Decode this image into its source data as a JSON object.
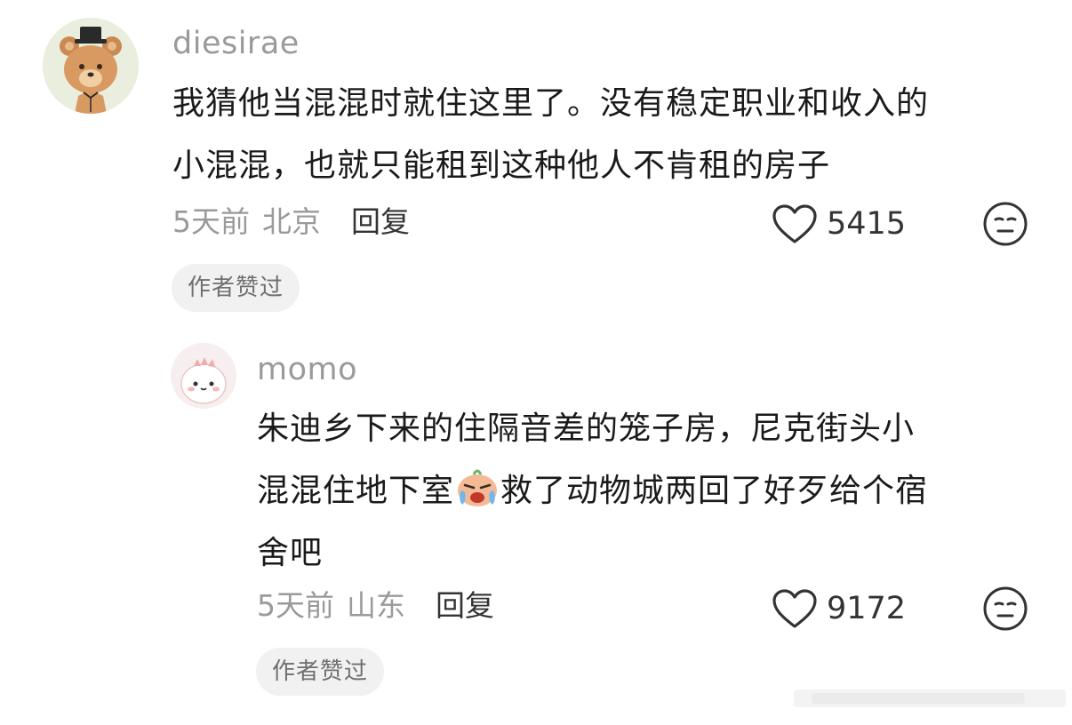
{
  "comments": [
    {
      "username": "diesirae",
      "text_line1": "我猜他当混混时就住这里了。没有稳定职业和收入的",
      "text_line2": "小混混，也就只能租到这种他人不肯租的房子",
      "time": "5天前",
      "region": "北京",
      "reply_label": "回复",
      "likes": "5415",
      "badge": "作者赞过",
      "avatar_icon": "teddy-bear-avatar-icon"
    },
    {
      "username": "momo",
      "text_line1": "朱迪乡下来的住隔音差的笼子房，尼克街头小",
      "text_line2_before": "混混住地下室",
      "text_line2_after": "救了动物城两回了好歹给个宿",
      "text_line3": "舍吧",
      "inline_emoji": "crying-face-emoji",
      "time": "5天前",
      "region": "山东",
      "reply_label": "回复",
      "likes": "9172",
      "badge": "作者赞过",
      "avatar_icon": "pink-dino-avatar-icon"
    }
  ],
  "icons": {
    "like": "heart-outline-icon",
    "emoji": "neutral-face-icon"
  },
  "colors": {
    "username": "#9a9a9a",
    "body_text": "#1a1a1a",
    "meta": "#9a9a9a",
    "badge_bg": "#f1f1f1",
    "badge_text": "#6f6f6f"
  }
}
